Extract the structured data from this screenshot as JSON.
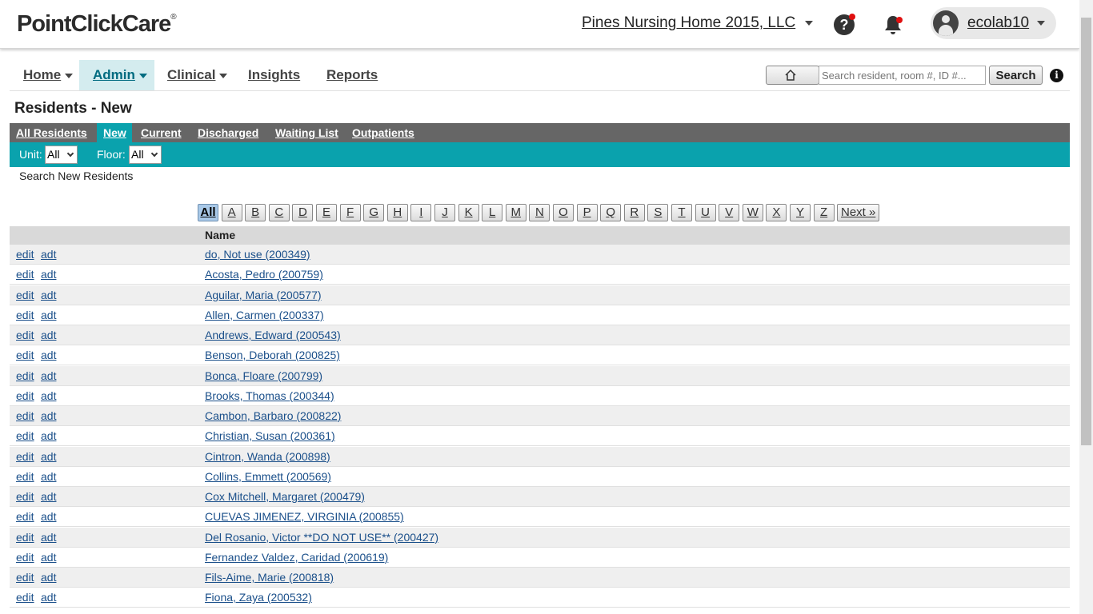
{
  "header": {
    "logo_text": "PointClickCare",
    "logo_mark": "®",
    "facility": "Pines Nursing Home 2015, LLC",
    "username": "ecolab10",
    "help_glyph": "?"
  },
  "nav": {
    "items": [
      {
        "label": "Home",
        "dropdown": true
      },
      {
        "label": "Admin",
        "dropdown": true,
        "active": true
      },
      {
        "label": "Clinical",
        "dropdown": true
      },
      {
        "label": "Insights",
        "dropdown": false
      },
      {
        "label": "Reports",
        "dropdown": false
      }
    ],
    "search_placeholder": "Search resident, room #, ID #...",
    "search_value": "",
    "search_button": "Search",
    "info_glyph": "i"
  },
  "page": {
    "title": "Residents - New",
    "tabs": [
      "All Residents",
      "New",
      "Current",
      "Discharged",
      "Waiting List",
      "Outpatients"
    ],
    "active_tab": "New",
    "unit_label": "Unit:",
    "unit_value": "All",
    "floor_label": "Floor:",
    "floor_value": "All",
    "caption": "Search New Residents"
  },
  "alphabet": [
    "All",
    "A",
    "B",
    "C",
    "D",
    "E",
    "F",
    "G",
    "H",
    "I",
    "J",
    "K",
    "L",
    "M",
    "N",
    "O",
    "P",
    "Q",
    "R",
    "S",
    "T",
    "U",
    "V",
    "W",
    "X",
    "Y",
    "Z",
    "Next »"
  ],
  "table": {
    "header": "Name",
    "edit_label": "edit",
    "adt_label": "adt",
    "rows": [
      "do, Not use (200349)",
      "Acosta, Pedro (200759)",
      "Aguilar, Maria (200577)",
      "Allen, Carmen (200337)",
      "Andrews, Edward (200543)",
      "Benson, Deborah (200825)",
      "Bonca, Floare (200799)",
      "Brooks, Thomas (200344)",
      "Cambon, Barbaro (200822)",
      "Christian, Susan (200361)",
      "Cintron, Wanda (200898)",
      "Collins, Emmett (200569)",
      "Cox Mitchell, Margaret (200479)",
      "CUEVAS JIMENEZ, VIRGINIA (200855)",
      "Del Rosanio, Victor **DO NOT USE** (200427)",
      "Fernandez Valdez, Caridad (200619)",
      "Fils-Aime, Marie (200818)",
      "Fiona, Zaya (200532)"
    ]
  },
  "colors": {
    "accent": "#0aa2ad",
    "tabbar": "#666666",
    "link": "#1a4f8a",
    "notification_dot": "#e01010"
  }
}
